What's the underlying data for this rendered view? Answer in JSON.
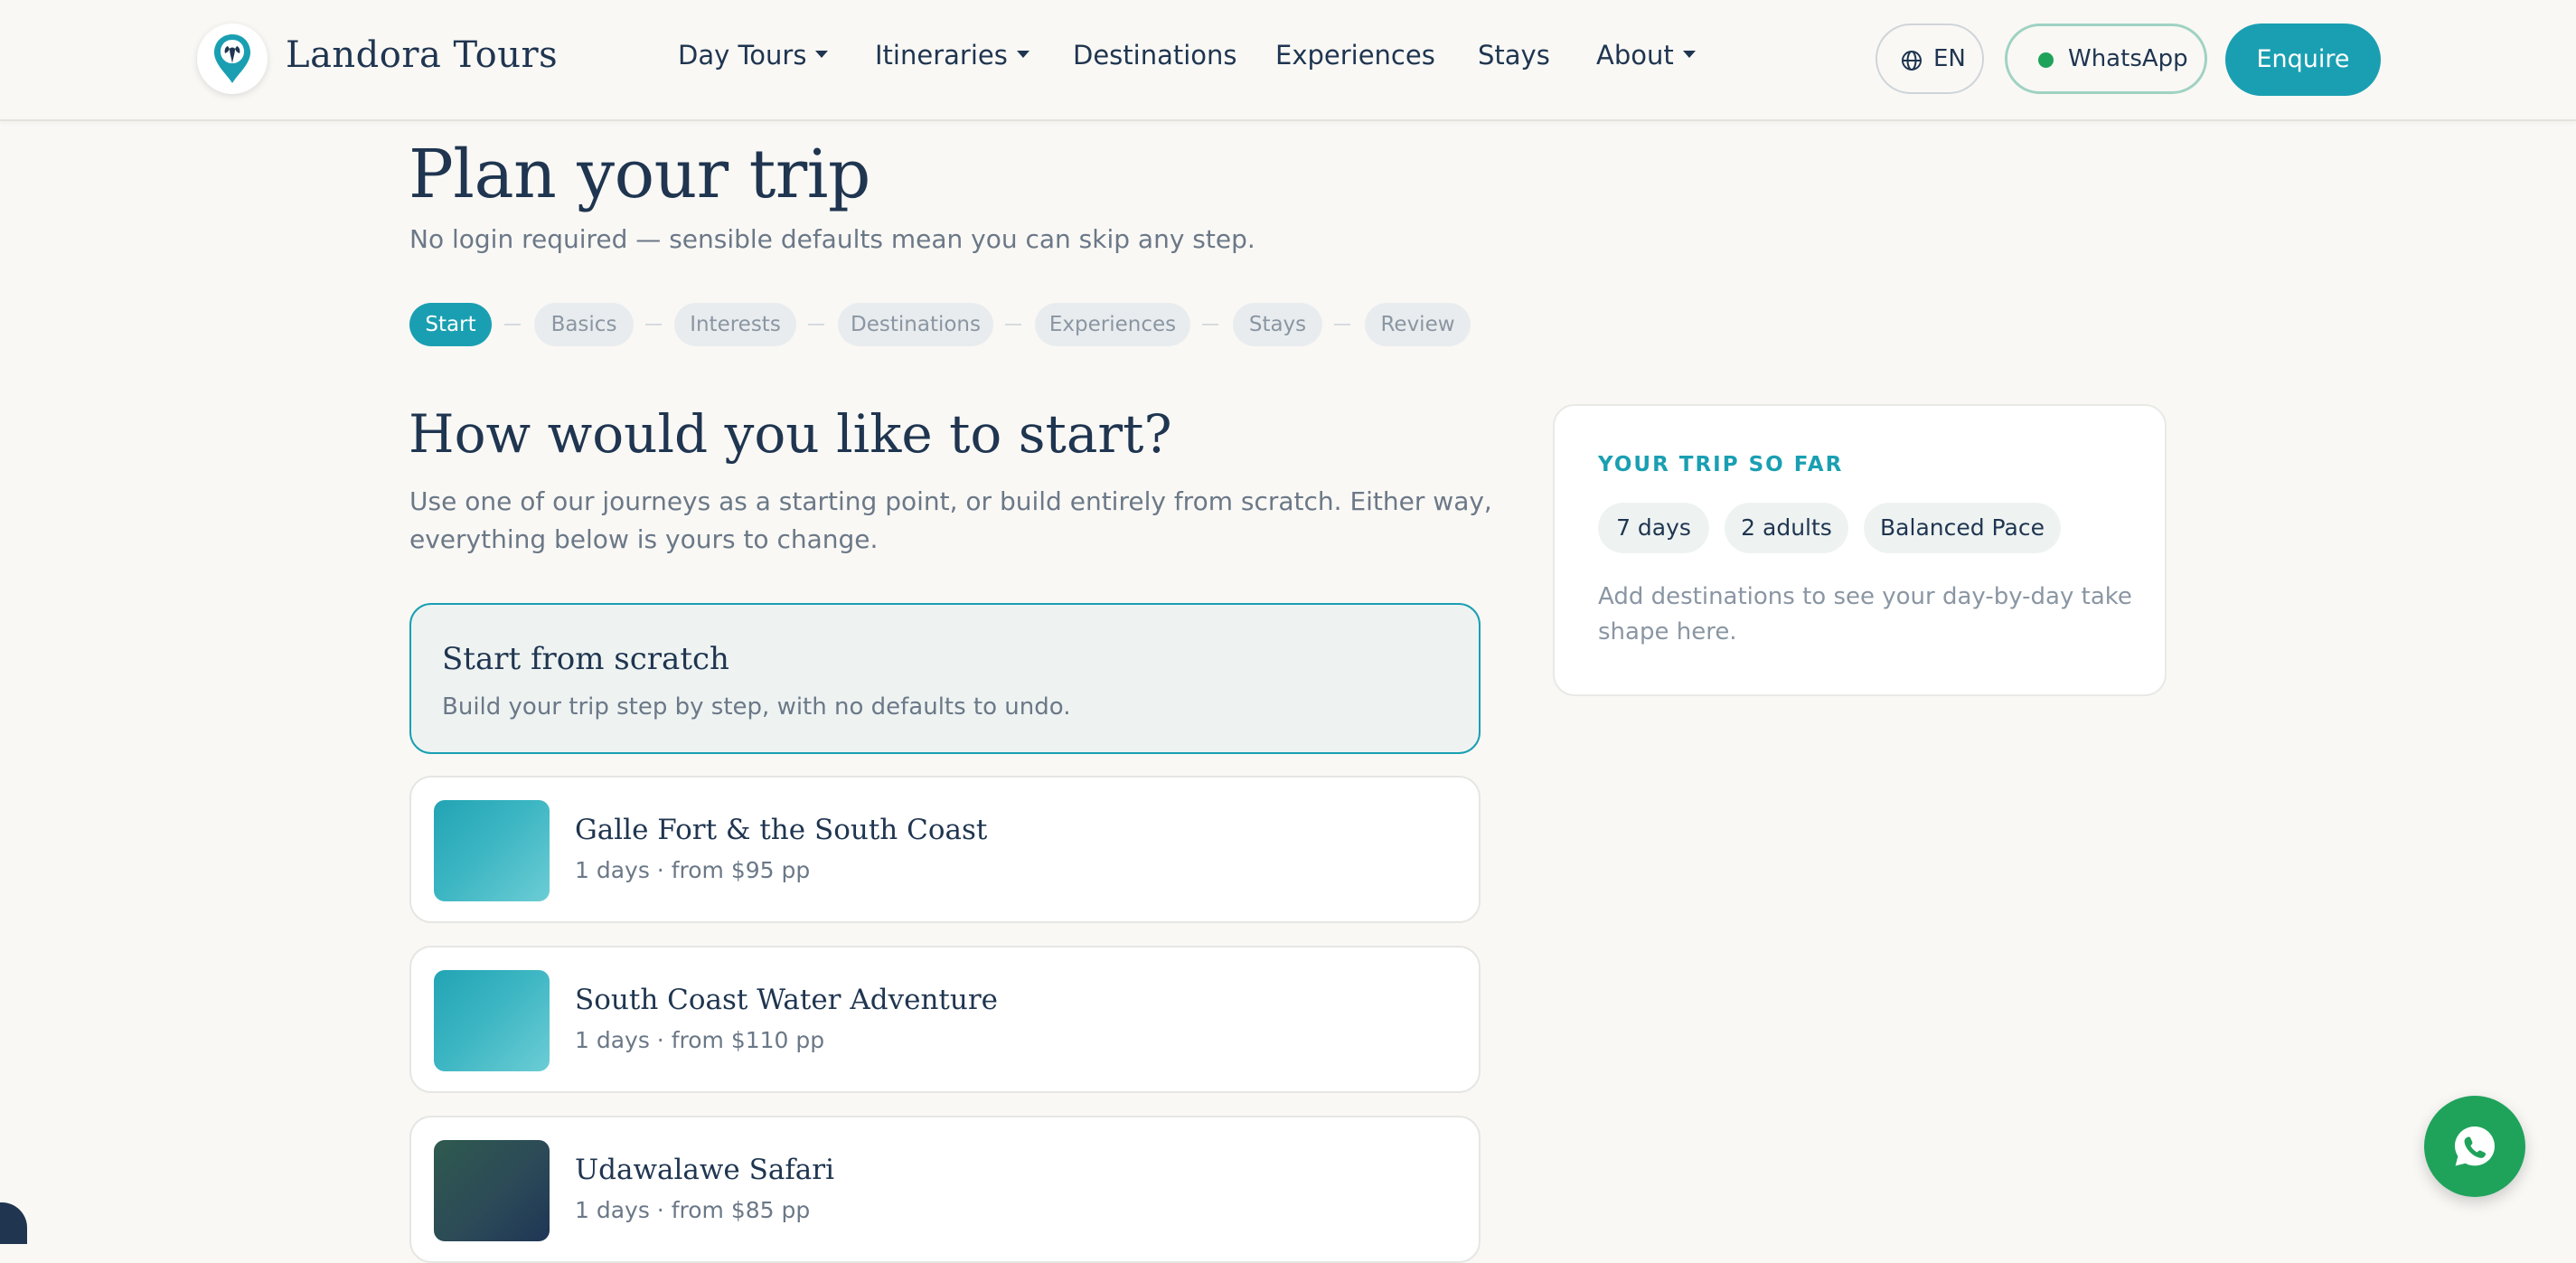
{
  "brand": {
    "name": "Landora Tours"
  },
  "nav": {
    "items": [
      {
        "label": "Day Tours",
        "dropdown": true
      },
      {
        "label": "Itineraries",
        "dropdown": true
      },
      {
        "label": "Destinations",
        "dropdown": false
      },
      {
        "label": "Experiences",
        "dropdown": false
      },
      {
        "label": "Stays",
        "dropdown": false
      },
      {
        "label": "About",
        "dropdown": true
      }
    ]
  },
  "header_actions": {
    "language": "EN",
    "whatsapp_label": "WhatsApp",
    "enquire_label": "Enquire"
  },
  "page": {
    "title": "Plan your trip",
    "subtitle": "No login required — sensible defaults mean you can skip any step."
  },
  "steps": [
    {
      "label": "Start",
      "active": true
    },
    {
      "label": "Basics",
      "active": false
    },
    {
      "label": "Interests",
      "active": false
    },
    {
      "label": "Destinations",
      "active": false
    },
    {
      "label": "Experiences",
      "active": false
    },
    {
      "label": "Stays",
      "active": false
    },
    {
      "label": "Review",
      "active": false
    }
  ],
  "start_section": {
    "title": "How would you like to start?",
    "subtitle": "Use one of our journeys as a starting point, or build entirely from scratch. Either way, everything below is yours to change.",
    "scratch": {
      "title": "Start from scratch",
      "description": "Build your trip step by step, with no defaults to undo.",
      "selected": true
    },
    "tours": [
      {
        "title": "Galle Fort & the South Coast",
        "meta": "1 days · from $95 pp"
      },
      {
        "title": "South Coast Water Adventure",
        "meta": "1 days · from $110 pp"
      },
      {
        "title": "Udawalawe Safari",
        "meta": "1 days · from $85 pp"
      }
    ]
  },
  "summary": {
    "eyebrow": "YOUR TRIP SO FAR",
    "chips": [
      "7 days",
      "2 adults",
      "Balanced Pace"
    ],
    "note": "Add destinations to see your day-by-day take shape here."
  },
  "colors": {
    "accent": "#1a9fb2",
    "navy": "#1f3550",
    "whatsapp": "#1fa35b",
    "background": "#f9f8f5"
  },
  "icons": {
    "logo": "elephant-pin-icon",
    "language": "globe-icon",
    "whatsapp_status": "status-dot-icon",
    "fab": "whatsapp-icon"
  }
}
